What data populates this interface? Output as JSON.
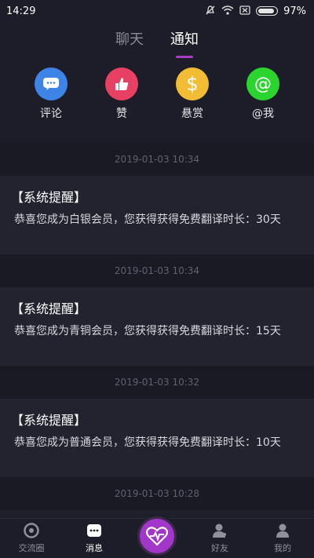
{
  "status": {
    "time": "14:29",
    "battery": "97%"
  },
  "tabs": [
    {
      "label": "聊天",
      "active": false
    },
    {
      "label": "通知",
      "active": true
    }
  ],
  "shortcuts": [
    {
      "label": "评论",
      "icon": "comment-icon",
      "color": "#3d84e6",
      "glyph": "···"
    },
    {
      "label": "赞",
      "icon": "thumbs-up-icon",
      "color": "#e84063",
      "glyph": "👍"
    },
    {
      "label": "悬赏",
      "icon": "dollar-icon",
      "color": "#f2bd34",
      "glyph": "$"
    },
    {
      "label": "@我",
      "icon": "at-icon",
      "color": "#2bd42e",
      "glyph": "@"
    }
  ],
  "notifications": [
    {
      "time": "2019-01-03 10:34",
      "title": "【系统提醒】",
      "body": "恭喜您成为白银会员，您获得获得免费翻译时长：30天"
    },
    {
      "time": "2019-01-03 10:34",
      "title": "【系统提醒】",
      "body": "恭喜您成为青铜会员，您获得获得免费翻译时长：15天"
    },
    {
      "time": "2019-01-03 10:32",
      "title": "【系统提醒】",
      "body": "恭喜您成为普通会员，您获得获得免费翻译时长：10天"
    },
    {
      "time": "2019-01-03 10:28"
    }
  ],
  "nav": [
    {
      "label": "交流圈",
      "icon": "community-icon"
    },
    {
      "label": "消息",
      "icon": "message-icon",
      "active": true
    },
    {
      "label": "",
      "icon": "heartbeat-icon",
      "center": true
    },
    {
      "label": "好友",
      "icon": "friends-icon"
    },
    {
      "label": "我的",
      "icon": "profile-icon"
    }
  ],
  "colors": {
    "accent": "#a83cc6",
    "background": "#1e1f2b"
  }
}
